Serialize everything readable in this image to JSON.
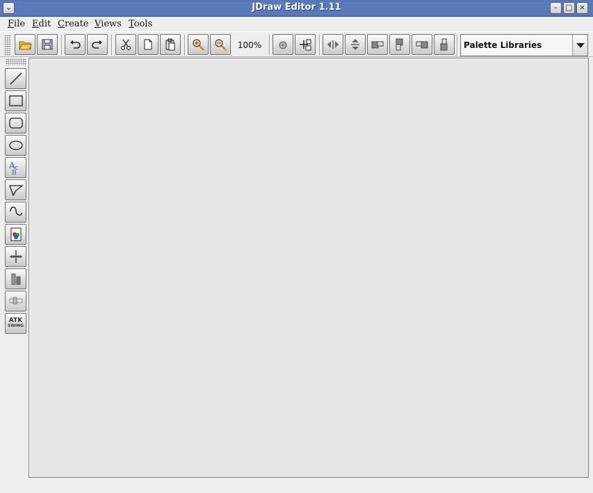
{
  "window": {
    "title": "JDraw Editor 1.11",
    "controls": [
      "window-menu-icon",
      "minimize-icon",
      "maximize-icon",
      "close-icon"
    ]
  },
  "menubar": {
    "items": [
      {
        "label": "File",
        "mnemonic": "F",
        "rest": "ile"
      },
      {
        "label": "Edit",
        "mnemonic": "E",
        "rest": "dit"
      },
      {
        "label": "Create",
        "mnemonic": "C",
        "rest": "reate"
      },
      {
        "label": "Views",
        "mnemonic": "V",
        "rest": "iews"
      },
      {
        "label": "Tools",
        "mnemonic": "T",
        "rest": "ools"
      }
    ]
  },
  "toolbar": {
    "zoom_level": "100%",
    "buttons": [
      "open-icon",
      "save-icon",
      "undo-icon",
      "redo-icon",
      "cut-icon",
      "copy-icon",
      "paste-icon",
      "zoom-in-icon",
      "zoom-out-icon",
      "group-icon",
      "move-icon",
      "flip-horizontal-icon",
      "flip-vertical-icon",
      "align-left-icon",
      "align-top-icon",
      "align-right-icon",
      "align-bottom-icon"
    ],
    "palette_select": {
      "value": "Palette Libraries"
    }
  },
  "tool_palette": {
    "tools": [
      "line-tool-icon",
      "rectangle-tool-icon",
      "rounded-rectangle-tool-icon",
      "ellipse-tool-icon",
      "text-tool-icon",
      "polyline-tool-icon",
      "spline-tool-icon",
      "image-tool-icon",
      "axis-tool-icon",
      "bar-tool-icon",
      "slider-tool-icon",
      "atk-swing-tool-icon"
    ],
    "atk_label": "ATK",
    "atk_sublabel": "SWING"
  },
  "colors": {
    "title_bar": "#5777b8",
    "canvas": "#e6e6e6",
    "background": "#eeeeee"
  }
}
